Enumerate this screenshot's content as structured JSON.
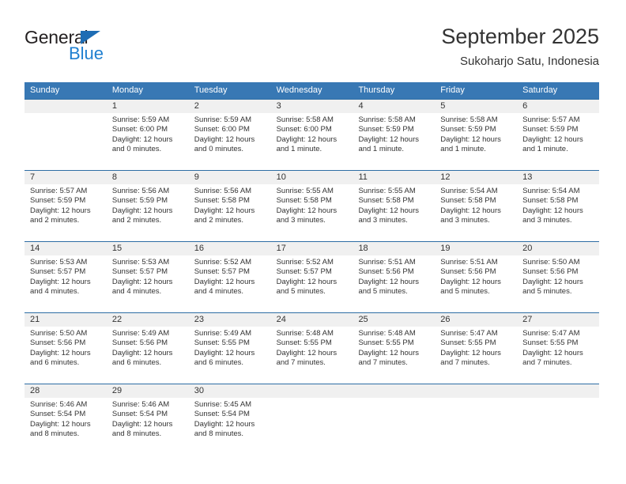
{
  "logo": {
    "text_top": "General",
    "text_bottom": "Blue",
    "triangle_color": "#1f6db4",
    "blue_color": "#1f7fd0"
  },
  "header": {
    "title": "September 2025",
    "subtitle": "Sukoharjo Satu, Indonesia"
  },
  "theme": {
    "header_bg": "#3878b4",
    "week_border": "#2e6da4",
    "day_strip_bg": "#f0f0f0",
    "text": "#333333"
  },
  "weekdays": [
    "Sunday",
    "Monday",
    "Tuesday",
    "Wednesday",
    "Thursday",
    "Friday",
    "Saturday"
  ],
  "weeks": [
    [
      {
        "day": "",
        "lines": []
      },
      {
        "day": "1",
        "lines": [
          "Sunrise: 5:59 AM",
          "Sunset: 6:00 PM",
          "Daylight: 12 hours",
          "and 0 minutes."
        ]
      },
      {
        "day": "2",
        "lines": [
          "Sunrise: 5:59 AM",
          "Sunset: 6:00 PM",
          "Daylight: 12 hours",
          "and 0 minutes."
        ]
      },
      {
        "day": "3",
        "lines": [
          "Sunrise: 5:58 AM",
          "Sunset: 6:00 PM",
          "Daylight: 12 hours",
          "and 1 minute."
        ]
      },
      {
        "day": "4",
        "lines": [
          "Sunrise: 5:58 AM",
          "Sunset: 5:59 PM",
          "Daylight: 12 hours",
          "and 1 minute."
        ]
      },
      {
        "day": "5",
        "lines": [
          "Sunrise: 5:58 AM",
          "Sunset: 5:59 PM",
          "Daylight: 12 hours",
          "and 1 minute."
        ]
      },
      {
        "day": "6",
        "lines": [
          "Sunrise: 5:57 AM",
          "Sunset: 5:59 PM",
          "Daylight: 12 hours",
          "and 1 minute."
        ]
      }
    ],
    [
      {
        "day": "7",
        "lines": [
          "Sunrise: 5:57 AM",
          "Sunset: 5:59 PM",
          "Daylight: 12 hours",
          "and 2 minutes."
        ]
      },
      {
        "day": "8",
        "lines": [
          "Sunrise: 5:56 AM",
          "Sunset: 5:59 PM",
          "Daylight: 12 hours",
          "and 2 minutes."
        ]
      },
      {
        "day": "9",
        "lines": [
          "Sunrise: 5:56 AM",
          "Sunset: 5:58 PM",
          "Daylight: 12 hours",
          "and 2 minutes."
        ]
      },
      {
        "day": "10",
        "lines": [
          "Sunrise: 5:55 AM",
          "Sunset: 5:58 PM",
          "Daylight: 12 hours",
          "and 3 minutes."
        ]
      },
      {
        "day": "11",
        "lines": [
          "Sunrise: 5:55 AM",
          "Sunset: 5:58 PM",
          "Daylight: 12 hours",
          "and 3 minutes."
        ]
      },
      {
        "day": "12",
        "lines": [
          "Sunrise: 5:54 AM",
          "Sunset: 5:58 PM",
          "Daylight: 12 hours",
          "and 3 minutes."
        ]
      },
      {
        "day": "13",
        "lines": [
          "Sunrise: 5:54 AM",
          "Sunset: 5:58 PM",
          "Daylight: 12 hours",
          "and 3 minutes."
        ]
      }
    ],
    [
      {
        "day": "14",
        "lines": [
          "Sunrise: 5:53 AM",
          "Sunset: 5:57 PM",
          "Daylight: 12 hours",
          "and 4 minutes."
        ]
      },
      {
        "day": "15",
        "lines": [
          "Sunrise: 5:53 AM",
          "Sunset: 5:57 PM",
          "Daylight: 12 hours",
          "and 4 minutes."
        ]
      },
      {
        "day": "16",
        "lines": [
          "Sunrise: 5:52 AM",
          "Sunset: 5:57 PM",
          "Daylight: 12 hours",
          "and 4 minutes."
        ]
      },
      {
        "day": "17",
        "lines": [
          "Sunrise: 5:52 AM",
          "Sunset: 5:57 PM",
          "Daylight: 12 hours",
          "and 5 minutes."
        ]
      },
      {
        "day": "18",
        "lines": [
          "Sunrise: 5:51 AM",
          "Sunset: 5:56 PM",
          "Daylight: 12 hours",
          "and 5 minutes."
        ]
      },
      {
        "day": "19",
        "lines": [
          "Sunrise: 5:51 AM",
          "Sunset: 5:56 PM",
          "Daylight: 12 hours",
          "and 5 minutes."
        ]
      },
      {
        "day": "20",
        "lines": [
          "Sunrise: 5:50 AM",
          "Sunset: 5:56 PM",
          "Daylight: 12 hours",
          "and 5 minutes."
        ]
      }
    ],
    [
      {
        "day": "21",
        "lines": [
          "Sunrise: 5:50 AM",
          "Sunset: 5:56 PM",
          "Daylight: 12 hours",
          "and 6 minutes."
        ]
      },
      {
        "day": "22",
        "lines": [
          "Sunrise: 5:49 AM",
          "Sunset: 5:56 PM",
          "Daylight: 12 hours",
          "and 6 minutes."
        ]
      },
      {
        "day": "23",
        "lines": [
          "Sunrise: 5:49 AM",
          "Sunset: 5:55 PM",
          "Daylight: 12 hours",
          "and 6 minutes."
        ]
      },
      {
        "day": "24",
        "lines": [
          "Sunrise: 5:48 AM",
          "Sunset: 5:55 PM",
          "Daylight: 12 hours",
          "and 7 minutes."
        ]
      },
      {
        "day": "25",
        "lines": [
          "Sunrise: 5:48 AM",
          "Sunset: 5:55 PM",
          "Daylight: 12 hours",
          "and 7 minutes."
        ]
      },
      {
        "day": "26",
        "lines": [
          "Sunrise: 5:47 AM",
          "Sunset: 5:55 PM",
          "Daylight: 12 hours",
          "and 7 minutes."
        ]
      },
      {
        "day": "27",
        "lines": [
          "Sunrise: 5:47 AM",
          "Sunset: 5:55 PM",
          "Daylight: 12 hours",
          "and 7 minutes."
        ]
      }
    ],
    [
      {
        "day": "28",
        "lines": [
          "Sunrise: 5:46 AM",
          "Sunset: 5:54 PM",
          "Daylight: 12 hours",
          "and 8 minutes."
        ]
      },
      {
        "day": "29",
        "lines": [
          "Sunrise: 5:46 AM",
          "Sunset: 5:54 PM",
          "Daylight: 12 hours",
          "and 8 minutes."
        ]
      },
      {
        "day": "30",
        "lines": [
          "Sunrise: 5:45 AM",
          "Sunset: 5:54 PM",
          "Daylight: 12 hours",
          "and 8 minutes."
        ]
      },
      {
        "day": "",
        "lines": []
      },
      {
        "day": "",
        "lines": []
      },
      {
        "day": "",
        "lines": []
      },
      {
        "day": "",
        "lines": []
      }
    ]
  ]
}
